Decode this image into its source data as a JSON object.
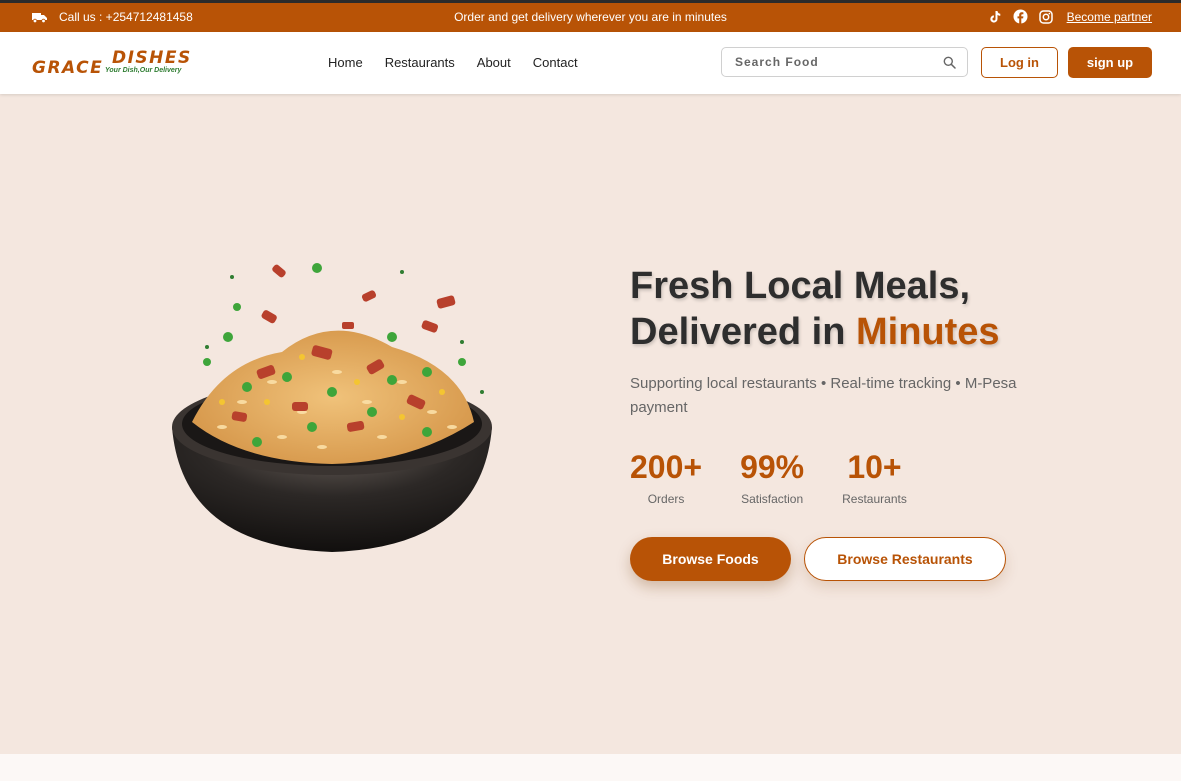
{
  "topbar": {
    "call_text": "Call us : +254712481458",
    "promo_text": "Order and get delivery wherever you are in minutes",
    "partner_link": "Become partner",
    "icons": [
      "truck-icon",
      "tiktok-icon",
      "facebook-icon",
      "instagram-icon"
    ]
  },
  "logo": {
    "word1": "GRACE",
    "word2": "DISHES",
    "tagline": "Your Dish,Our Delivery"
  },
  "nav": {
    "items": [
      {
        "label": "Home"
      },
      {
        "label": "Restaurants"
      },
      {
        "label": "About"
      },
      {
        "label": "Contact"
      }
    ]
  },
  "search": {
    "placeholder": "Search Food",
    "value": ""
  },
  "auth": {
    "login_label": "Log in",
    "signup_label": "sign up"
  },
  "hero": {
    "title_line1": "Fresh Local Meals,",
    "title_line2_prefix": "Delivered in",
    "title_line2_accent": "Minutes",
    "subtitle": "Supporting local restaurants • Real-time tracking • M-Pesa payment",
    "stats": [
      {
        "value": "200+",
        "label": "Orders"
      },
      {
        "value": "99%",
        "label": "Satisfaction"
      },
      {
        "value": "10+",
        "label": "Restaurants"
      }
    ],
    "primary_button": "Browse Foods",
    "secondary_button": "Browse Restaurants"
  },
  "colors": {
    "brand": "#b85306",
    "hero_bg": "#f4e7df",
    "text_dark": "#2e2e2e",
    "logo_tagline": "#2f7d32"
  }
}
